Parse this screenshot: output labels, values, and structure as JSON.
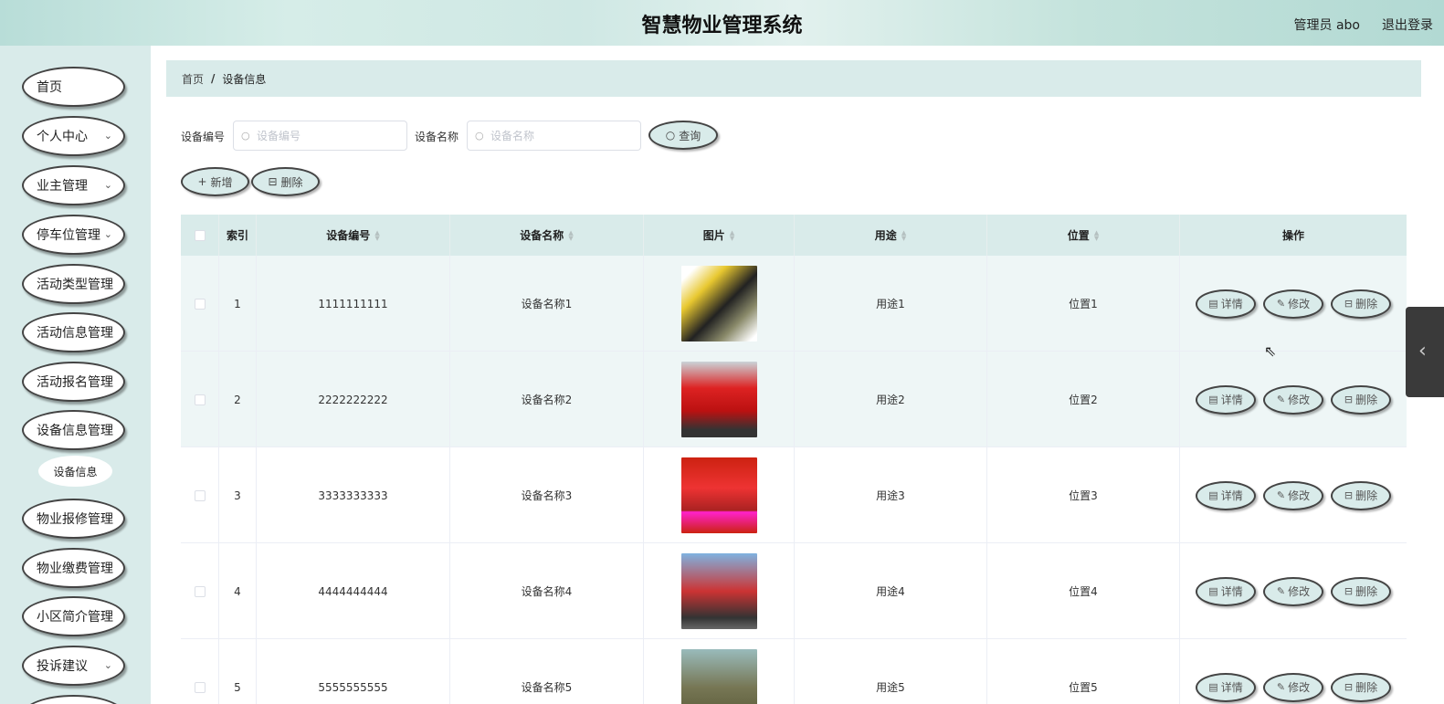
{
  "header": {
    "title": "智慧物业管理系统",
    "user": "管理员 abo",
    "logout": "退出登录"
  },
  "sidebar": {
    "items": [
      {
        "label": "首页",
        "chevron": false
      },
      {
        "label": "个人中心",
        "chevron": true
      },
      {
        "label": "业主管理",
        "chevron": true
      },
      {
        "label": "停车位管理",
        "chevron": true
      },
      {
        "label": "活动类型管理",
        "chevron": false
      },
      {
        "label": "活动信息管理",
        "chevron": false
      },
      {
        "label": "活动报名管理",
        "chevron": false
      },
      {
        "label": "设备信息管理",
        "chevron": false
      },
      {
        "label": "物业报修管理",
        "chevron": false
      },
      {
        "label": "物业缴费管理",
        "chevron": false
      },
      {
        "label": "小区简介管理",
        "chevron": false
      },
      {
        "label": "投诉建议",
        "chevron": true
      }
    ],
    "submenu": "设备信息"
  },
  "breadcrumb": {
    "home": "首页",
    "sep": "/",
    "current": "设备信息"
  },
  "search": {
    "code_label": "设备编号",
    "code_placeholder": "设备编号",
    "name_label": "设备名称",
    "name_placeholder": "设备名称",
    "query_button": "查询"
  },
  "actions": {
    "add": "新增",
    "delete": "删除"
  },
  "table": {
    "headers": {
      "index": "索引",
      "code": "设备编号",
      "name": "设备名称",
      "image": "图片",
      "usage": "用途",
      "location": "位置",
      "ops": "操作"
    },
    "ops": {
      "detail": "详情",
      "edit": "修改",
      "delete": "删除"
    },
    "rows": [
      {
        "index": "1",
        "code": "1111111111",
        "name": "设备名称1",
        "usage": "用途1",
        "location": "位置1"
      },
      {
        "index": "2",
        "code": "2222222222",
        "name": "设备名称2",
        "usage": "用途2",
        "location": "位置2"
      },
      {
        "index": "3",
        "code": "3333333333",
        "name": "设备名称3",
        "usage": "用途3",
        "location": "位置3"
      },
      {
        "index": "4",
        "code": "4444444444",
        "name": "设备名称4",
        "usage": "用途4",
        "location": "位置4"
      },
      {
        "index": "5",
        "code": "5555555555",
        "name": "设备名称5",
        "usage": "用途5",
        "location": "位置5"
      }
    ]
  },
  "icons": {
    "search": "search-icon",
    "add": "plus-icon",
    "trash": "trash-icon",
    "detail": "document-icon",
    "edit": "pencil-icon",
    "chevron": "chevron-down-icon",
    "drawer": "chevron-left-icon"
  },
  "colors": {
    "accent": "#d9ebea",
    "border": "#444444"
  }
}
